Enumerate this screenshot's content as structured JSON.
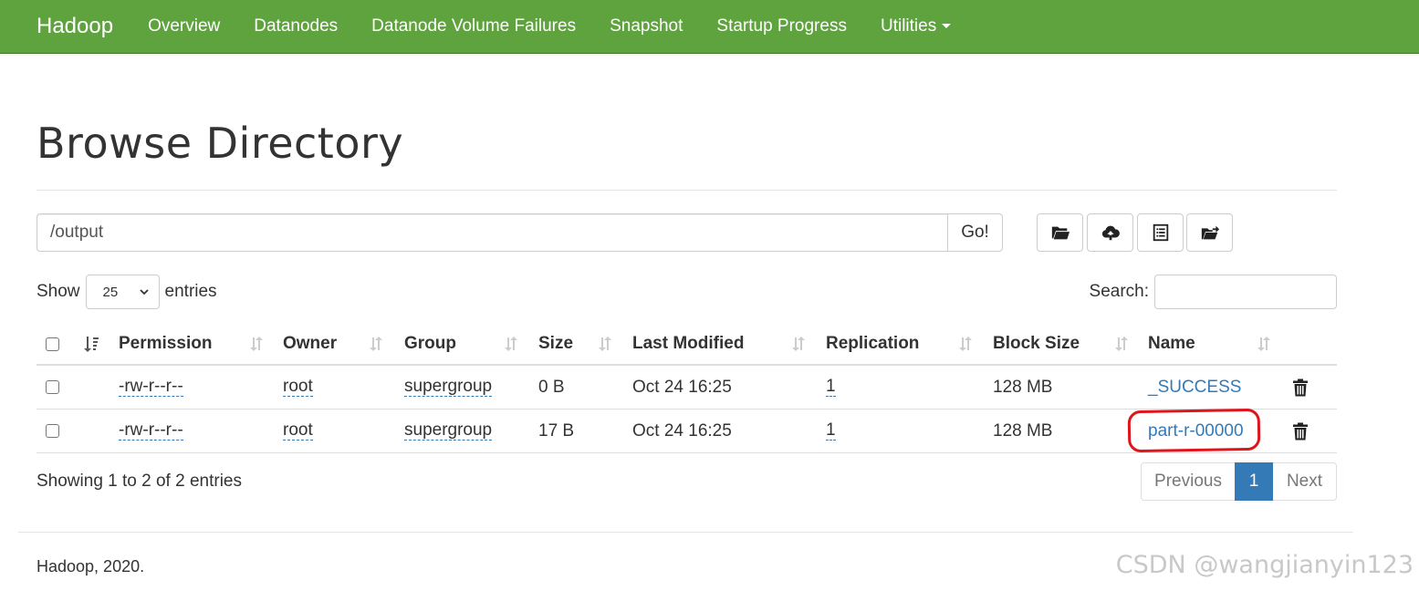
{
  "nav": {
    "brand": "Hadoop",
    "items": [
      {
        "label": "Overview"
      },
      {
        "label": "Datanodes"
      },
      {
        "label": "Datanode Volume Failures"
      },
      {
        "label": "Snapshot"
      },
      {
        "label": "Startup Progress"
      },
      {
        "label": "Utilities"
      }
    ]
  },
  "page": {
    "title": "Browse Directory"
  },
  "path": {
    "value": "/output",
    "go_label": "Go!"
  },
  "toolbar": {
    "icons": [
      "folder-open-icon",
      "cloud-upload-icon",
      "list-icon",
      "folder-move-icon"
    ]
  },
  "length": {
    "show_label": "Show",
    "selected": "25",
    "entries_label": "entries"
  },
  "search": {
    "label": "Search:",
    "value": ""
  },
  "table": {
    "headers": [
      "Permission",
      "Owner",
      "Group",
      "Size",
      "Last Modified",
      "Replication",
      "Block Size",
      "Name"
    ],
    "rows": [
      {
        "permission": "-rw-r--r--",
        "owner": "root",
        "group": "supergroup",
        "size": "0 B",
        "modified": "Oct 24 16:25",
        "replication": "1",
        "block_size": "128 MB",
        "name": "_SUCCESS"
      },
      {
        "permission": "-rw-r--r--",
        "owner": "root",
        "group": "supergroup",
        "size": "17 B",
        "modified": "Oct 24 16:25",
        "replication": "1",
        "block_size": "128 MB",
        "name": "part-r-00000"
      }
    ]
  },
  "info": {
    "text": "Showing 1 to 2 of 2 entries"
  },
  "pagination": {
    "previous": "Previous",
    "current": "1",
    "next": "Next"
  },
  "footer": {
    "text": "Hadoop, 2020."
  },
  "watermark": {
    "text": "CSDN @wangjianyin123"
  },
  "colors": {
    "navbar": "#5fa33e",
    "link": "#337ab7",
    "annotation": "#e0141b"
  }
}
